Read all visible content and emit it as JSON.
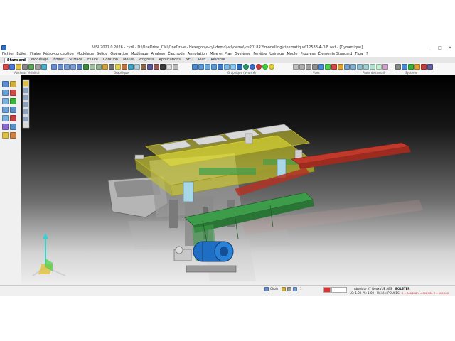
{
  "window": {
    "title": "VISI 2021.0.2026 - cyril - D:\\OneDrive_CMI\\OneDrive - Hexagon\\ε-cyl-demo\\vcl\\demo\\vis2018R2\\modelling\\cinematique\\12583-4-DIE.wkf - [Dynamique]",
    "minimize_glyph": "–",
    "maximize_glyph": "□",
    "close_glyph": "✕"
  },
  "menu": [
    "Fichier",
    "Editer",
    "Filaire",
    "Rétro-conception",
    "Modélage",
    "Solide",
    "Opération",
    "Modélage",
    "Analyse",
    "Électrode",
    "Annotation",
    "Mise en Plan",
    "Système",
    "Fenêtre",
    "Usinage",
    "Moule",
    "Progress",
    "Éléments Standard",
    "Flow",
    "?"
  ],
  "ribbon": {
    "tabs": [
      "Standard",
      "Modélage",
      "Éditer",
      "Surface",
      "Filaire",
      "Cotation",
      "Moule",
      "Progress",
      "Applications",
      "NEO",
      "Plan",
      "Réverse"
    ],
    "active_tab": "Standard",
    "groups": [
      "Attributs Visibilité",
      "Graphique",
      "Graphique (avancé)",
      "Vues",
      "Plans de travail",
      "Système"
    ]
  },
  "statusbar": {
    "selection": "Choix",
    "coord_system": "Absolute XY Deux",
    "view": "VUE ABS",
    "layer": "BOLSTER",
    "scale": "LS: 1.00 PS: 1.00",
    "units": "Unités: POUCES",
    "coords": "X = 006.228 Y = 046.380 Z = 000.000",
    "number": "1"
  },
  "colors": {
    "accent": "#2a6fc9",
    "mold_yellow": "#e6e12a",
    "strip_red": "#c0392b",
    "conveyor_green": "#3c9c4a",
    "motor_blue": "#1e6fc4"
  }
}
